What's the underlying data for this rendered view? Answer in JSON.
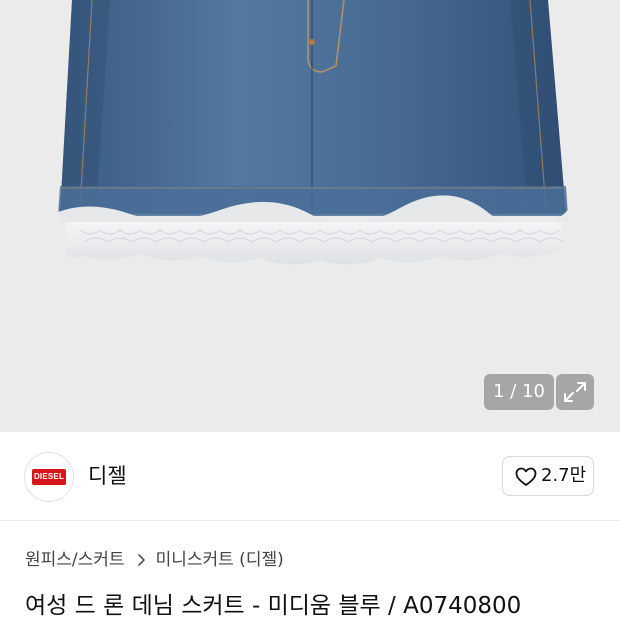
{
  "gallery": {
    "counter": "1 / 10",
    "product_image": "denim-mini-skirt-lace-hem",
    "expand_icon": "expand-icon"
  },
  "brand": {
    "logo_text": "DIESEL",
    "name": "디젤",
    "like_count": "2.7만",
    "like_icon": "heart-outline-icon"
  },
  "breadcrumb": {
    "level1": "원피스/스커트",
    "separator_icon": "chevron-right-icon",
    "level2": "미니스커트 (디젤)"
  },
  "product": {
    "title": "여성 드 론 데님 스커트 - 미디움 블루 / A0740800"
  },
  "colors": {
    "hero_bg": "#ebebeb",
    "denim": "#3f5f86",
    "lace": "#eceeef",
    "brand_red": "#d6161c"
  }
}
